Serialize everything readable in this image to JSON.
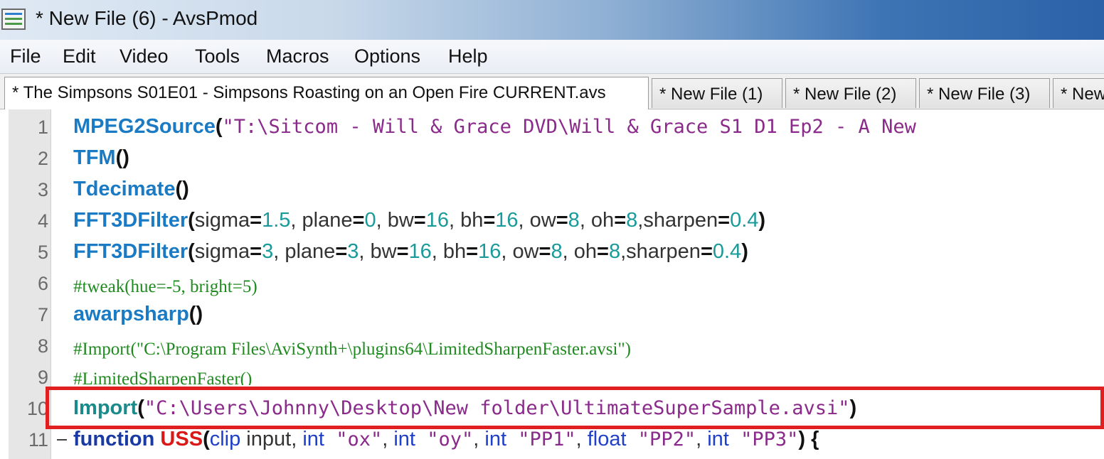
{
  "window": {
    "title": "* New File (6) - AvsPmod",
    "icon": "avspmod-app-icon"
  },
  "menu": [
    "File",
    "Edit",
    "Video",
    "Tools",
    "Macros",
    "Options",
    "Help"
  ],
  "tabs": [
    {
      "label": "* The Simpsons S01E01 - Simpsons Roasting on an Open Fire  CURRENT.avs",
      "active": true
    },
    {
      "label": "* New File (1)",
      "active": false
    },
    {
      "label": "* New File (2)",
      "active": false
    },
    {
      "label": "* New File (3)",
      "active": false
    },
    {
      "label": "* New",
      "active": false
    }
  ],
  "editor": {
    "line_numbers": [
      "1",
      "2",
      "3",
      "4",
      "5",
      "6",
      "7",
      "8",
      "9",
      "10",
      "11"
    ],
    "lines": {
      "l1": {
        "fn": "MPEG2Source",
        "open": "(",
        "str": "\"T:\\Sitcom - Will & Grace DVD\\Will & Grace S1 D1 Ep2 - A New"
      },
      "l2": {
        "fn": "TFM",
        "parens": "()"
      },
      "l3": {
        "fn": "Tdecimate",
        "parens": "()"
      },
      "l4": {
        "fn": "FFT3DFilter",
        "open": "(",
        "p1": "sigma",
        "v1": "1.5",
        "p2": ", plane",
        "v2": "0",
        "p3": ", bw",
        "v3": "16",
        "p4": ", bh",
        "v4": "16",
        "p5": ", ow",
        "v5": "8",
        "p6": ", oh",
        "v6": "8",
        "p7": ",sharpen",
        "v7": "0.4",
        "close": ")"
      },
      "l5": {
        "fn": "FFT3DFilter",
        "open": "(",
        "p1": "sigma",
        "v1": "3",
        "p2": ", plane",
        "v2": "3",
        "p3": ", bw",
        "v3": "16",
        "p4": ", bh",
        "v4": "16",
        "p5": ", ow",
        "v5": "8",
        "p6": ", oh",
        "v6": "8",
        "p7": ",sharpen",
        "v7": "0.4",
        "close": ")"
      },
      "l6": {
        "comment": "#tweak(hue=-5, bright=5)"
      },
      "l7": {
        "fn": "awarpsharp",
        "parens": "()"
      },
      "l8": {
        "comment": "#Import(\"C:\\Program Files\\AviSynth+\\plugins64\\LimitedSharpenFaster.avsi\")"
      },
      "l9": {
        "comment": "#LimitedSharpenFaster()"
      },
      "l10": {
        "fn": "Import",
        "open": "(",
        "str": "\"C:\\Users\\Johnny\\Desktop\\New folder\\UltimateSuperSample.avsi\"",
        "close": ")"
      },
      "l11": {
        "kw": "function",
        "name": "USS",
        "open": "(",
        "t1": "clip",
        "a1": " input, ",
        "t2": "int",
        "s2": " \"ox\"",
        "c2": ", ",
        "t3": "int",
        "s3": " \"oy\"",
        "c3": ", ",
        "t4": "int",
        "s4": " \"PP1\"",
        "c4": ", ",
        "t5": "float",
        "s5": " \"PP2\"",
        "c5": ", ",
        "t6": "int",
        "s6": " \"PP3\"",
        "close": ") {"
      }
    }
  },
  "colors": {
    "highlight_box": "#e02020",
    "keyword": "#1a7bc4",
    "string": "#8a2a8a",
    "number": "#1a9a9a",
    "comment": "#1f8a1f"
  }
}
